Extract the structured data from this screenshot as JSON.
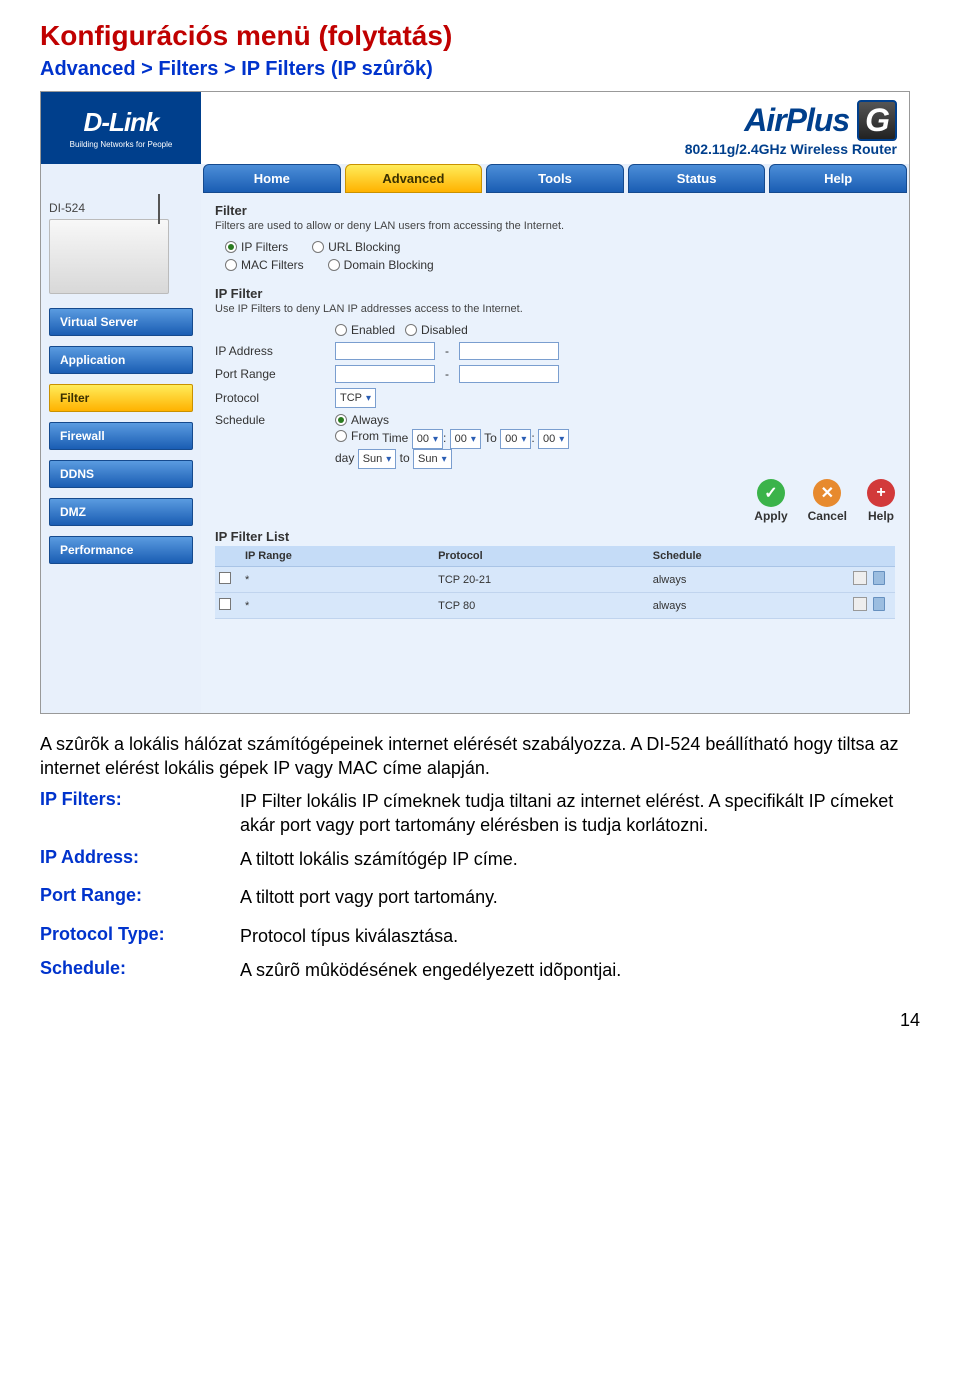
{
  "doc": {
    "title": "Konfigurációs menü (folytatás)",
    "subtitle": "Advanced > Filters > IP Filters (IP szûrõk)",
    "intro1": "A szûrõk a lokális hálózat számítógépeinek internet elérését szabályozza. A DI-524 beállítható hogy tiltsa az internet elérést lokális gépek IP vagy MAC címe alapján.",
    "page_number": "14"
  },
  "defs": [
    {
      "term": "IP Filters:",
      "desc": "IP Filter lokális IP címeknek tudja tiltani az internet elérést. A specifikált IP címeket akár port vagy port tartomány elérésben is tudja korlátozni."
    },
    {
      "term": "IP Address:",
      "desc": "A tiltott lokális számítógép IP címe."
    },
    {
      "term": "Port Range:",
      "desc": "A tiltott port vagy port tartomány."
    },
    {
      "term": "Protocol Type:",
      "desc": "Protocol típus kiválasztása."
    },
    {
      "term": "Schedule:",
      "desc": "A szûrõ mûködésének engedélyezett idõpontjai."
    }
  ],
  "shot": {
    "logo": {
      "brand": "D-Link",
      "tagline": "Building Networks for People"
    },
    "airplus": {
      "brand_left": "AirPlus",
      "brand_g": "G",
      "sub": "802.11g/2.4GHz Wireless Router"
    },
    "tabs": [
      "Home",
      "Advanced",
      "Tools",
      "Status",
      "Help"
    ],
    "active_tab": "Advanced",
    "product_label": "DI-524",
    "sidebar": [
      "Virtual Server",
      "Application",
      "Filter",
      "Firewall",
      "DDNS",
      "DMZ",
      "Performance"
    ],
    "active_side": "Filter",
    "filter_hdr": "Filter",
    "filter_hint": "Filters are used to allow or deny LAN users from accessing the Internet.",
    "filter_opts": {
      "r1": [
        "IP Filters",
        "URL Blocking"
      ],
      "r2": [
        "MAC Filters",
        "Domain Blocking"
      ],
      "selected": "IP Filters"
    },
    "ipfilter_hdr": "IP Filter",
    "ipfilter_hint": "Use IP Filters to deny LAN IP addresses access to the Internet.",
    "enable_opts": [
      "Enabled",
      "Disabled"
    ],
    "rows": {
      "ip": "IP Address",
      "port": "Port Range",
      "proto_label": "Protocol",
      "proto_value": "TCP",
      "dash": "-",
      "sched_label": "Schedule",
      "always": "Always",
      "from": "From",
      "time_label": "Time",
      "to_text": "To",
      "day_label": "day",
      "to_lc": "to",
      "h1": "00",
      "m1": "00",
      "h2": "00",
      "m2": "00",
      "d1": "Sun",
      "d2": "Sun"
    },
    "actions": {
      "apply": "Apply",
      "cancel": "Cancel",
      "help": "Help",
      "apply_sym": "✓",
      "cancel_sym": "✕",
      "help_sym": "+"
    },
    "list_hdr": "IP Filter List",
    "table": {
      "cols": [
        "IP Range",
        "Protocol",
        "Schedule"
      ],
      "rows": [
        {
          "ip": "*",
          "proto": "TCP 20-21",
          "sched": "always"
        },
        {
          "ip": "*",
          "proto": "TCP 80",
          "sched": "always"
        }
      ]
    }
  }
}
